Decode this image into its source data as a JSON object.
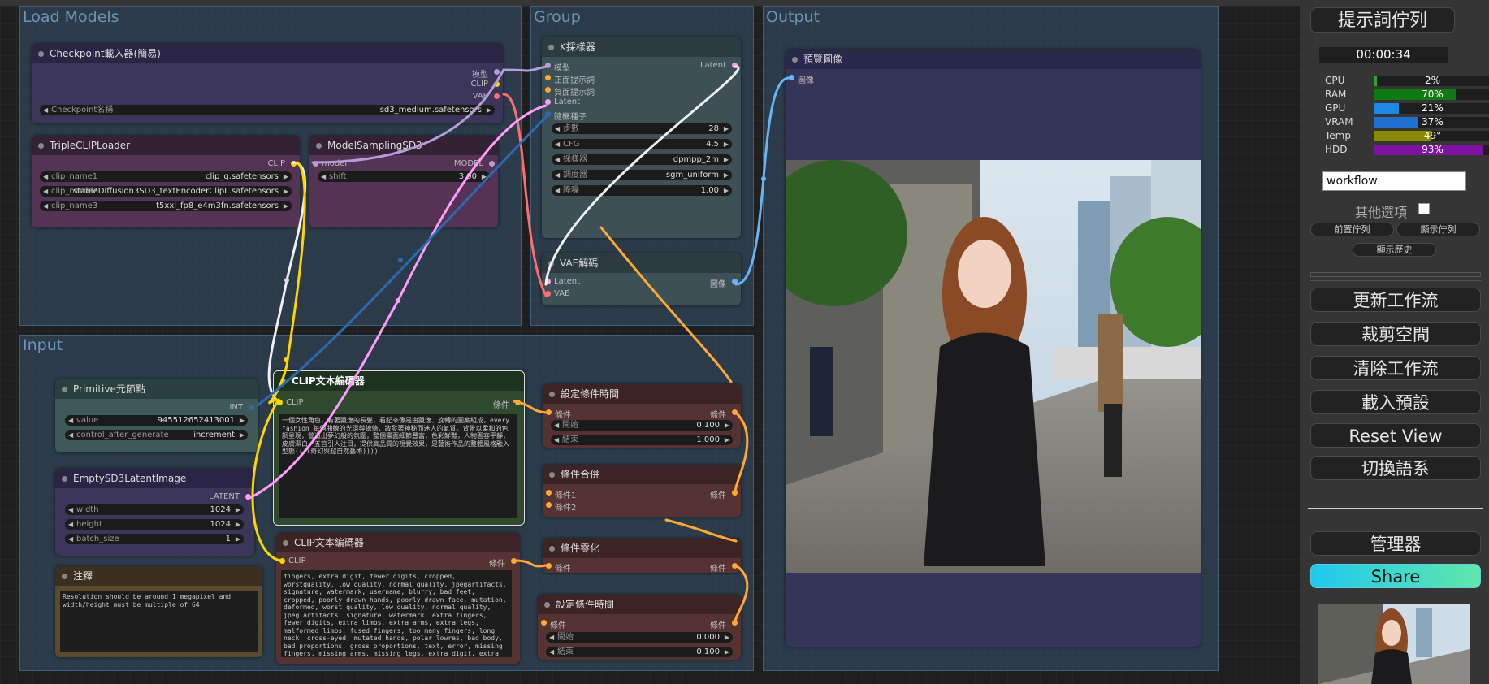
{
  "groups": {
    "load_models": "Load Models",
    "group": "Group",
    "output": "Output",
    "input": "Input"
  },
  "checkpoint": {
    "title": "Checkpoint載入器(簡易)",
    "out_model": "模型",
    "out_clip": "CLIP",
    "out_vae": "VAE",
    "w_label": "Checkpoint名稱",
    "w_value": "sd3_medium.safetensors"
  },
  "triple_clip": {
    "title": "TripleCLIPLoader",
    "out_clip": "CLIP",
    "w1_label": "clip_name1",
    "w1_value": "clip_g.safetensors",
    "w2_label": "clip_name2",
    "w2_value": "stableDiffusion3SD3_textEncoderClipL.safetensors",
    "w3_label": "clip_name3",
    "w3_value": "t5xxl_fp8_e4m3fn.safetensors"
  },
  "model_sampling": {
    "title": "ModelSamplingSD3",
    "in_model": "model",
    "out_model": "MODEL",
    "w_label": "shift",
    "w_value": "3.00"
  },
  "ksampler": {
    "title": "K採樣器",
    "in_model": "模型",
    "in_pos": "正面提示詞",
    "in_neg": "負面提示詞",
    "in_latent": "Latent",
    "in_seed": "隨機種子",
    "out_latent": "Latent",
    "widgets": [
      {
        "label": "步數",
        "value": "28"
      },
      {
        "label": "CFG",
        "value": "4.5"
      },
      {
        "label": "採樣器",
        "value": "dpmpp_2m"
      },
      {
        "label": "調度器",
        "value": "sgm_uniform"
      },
      {
        "label": "降噪",
        "value": "1.00"
      }
    ]
  },
  "vae_decode": {
    "title": "VAE解碼",
    "in_latent": "Latent",
    "in_vae": "VAE",
    "out_image": "圖像"
  },
  "preview": {
    "title": "預覽圖像",
    "in_image": "圖像"
  },
  "primitive": {
    "title": "Primitive元節點",
    "out_int": "INT",
    "w1_label": "value",
    "w1_value": "945512652413001",
    "w2_label": "control_after_generate",
    "w2_value": "increment"
  },
  "latent": {
    "title": "EmptySD3LatentImage",
    "out_latent": "LATENT",
    "w1_label": "width",
    "w1_value": "1024",
    "w2_label": "height",
    "w2_value": "1024",
    "w3_label": "batch_size",
    "w3_value": "1"
  },
  "note": {
    "title": "注釋",
    "text": "Resolution should be around 1 megapixel and width/height must be multiple of 64"
  },
  "clip_pos": {
    "title": "CLIP文本編碼器",
    "in_clip": "CLIP",
    "out_cond": "條件",
    "text": "一個女性角色，有著飄逸的長髮，看起來像是由飄逸、旋轉的圖案組成，every fashion 每個曲線的光環與線條，散發著神秘而迷人的氣質。背景以柔和的色調呈現，營造出夢幻般的氛圍，整個畫面細節豐富，色彩鮮豔，人物面容平靜，皮膚潔白，五官引人注目，提供高品質的視覺效果，是藝術作品的整體風格融入型態((((奇幻與超自然藝術))))"
  },
  "clip_neg": {
    "title": "CLIP文本編碼器",
    "in_clip": "CLIP",
    "out_cond": "條件",
    "text": "fingers, extra digit, fewer digits, cropped, worstquality, low quality, normal quality, jpegartifacts, signature, watermark, username, blurry, bad feet, cropped, poorly drawn hands, poorly drawn face, mutation, deformed, worst quality, low quality, normal quality, jpeg artifacts, signature, watermark, extra fingers, fewer digits, extra limbs, extra arms, extra legs, malformed limbs, fused fingers, too many fingers, long neck, cross-eyed, mutated hands, polar lowres, bad body, bad proportions, gross proportions, text, error, missing fingers, missing arms, missing legs, extra digit, extra arms, extra leg, extra foot, ((repeating hair)), extra fingers, cross-eye, squint, Umbrella,embedding:FastNegativeV2,"
  },
  "cond_timestep1": {
    "title": "設定條件時間",
    "in_cond": "條件",
    "out_cond": "條件",
    "w1_label": "開始",
    "w1_value": "0.100",
    "w2_label": "結束",
    "w2_value": "1.000"
  },
  "cond_combine": {
    "title": "條件合併",
    "in_cond1": "條件1",
    "in_cond2": "條件2",
    "out_cond": "條件"
  },
  "cond_zero": {
    "title": "條件零化",
    "in_cond": "條件",
    "out_cond": "條件"
  },
  "cond_timestep2": {
    "title": "設定條件時間",
    "in_cond": "條件",
    "out_cond": "條件",
    "w1_label": "開始",
    "w1_value": "0.000",
    "w2_label": "結束",
    "w2_value": "0.100"
  },
  "panel": {
    "queue_prompt": "提示詞佇列",
    "timer": "00:00:34",
    "stats": [
      {
        "label": "CPU",
        "value": "2%",
        "fraction": 0.02,
        "color": "#22aa22"
      },
      {
        "label": "RAM",
        "value": "70%",
        "fraction": 0.7,
        "color": "#0f7a12"
      },
      {
        "label": "GPU",
        "value": "21%",
        "fraction": 0.21,
        "color": "#1e88e5"
      },
      {
        "label": "VRAM",
        "value": "37%",
        "fraction": 0.37,
        "color": "#1f6fcf"
      },
      {
        "label": "Temp",
        "value": "49°",
        "fraction": 0.49,
        "color": "#8a8a00"
      },
      {
        "label": "HDD",
        "value": "93%",
        "fraction": 0.93,
        "color": "#7d12a3"
      }
    ],
    "workflow_value": "workflow",
    "extra_options": "其他選項",
    "view_queue_front": "前置佇列",
    "view_queue": "顯示佇列",
    "view_history": "顯示歷史",
    "update_workflow": "更新工作流",
    "clipspace": "裁剪空間",
    "clear_workflow": "清除工作流",
    "load_default": "載入預設",
    "reset_view": "Reset View",
    "switch_locale": "切換語系",
    "manager": "管理器",
    "share": "Share"
  }
}
